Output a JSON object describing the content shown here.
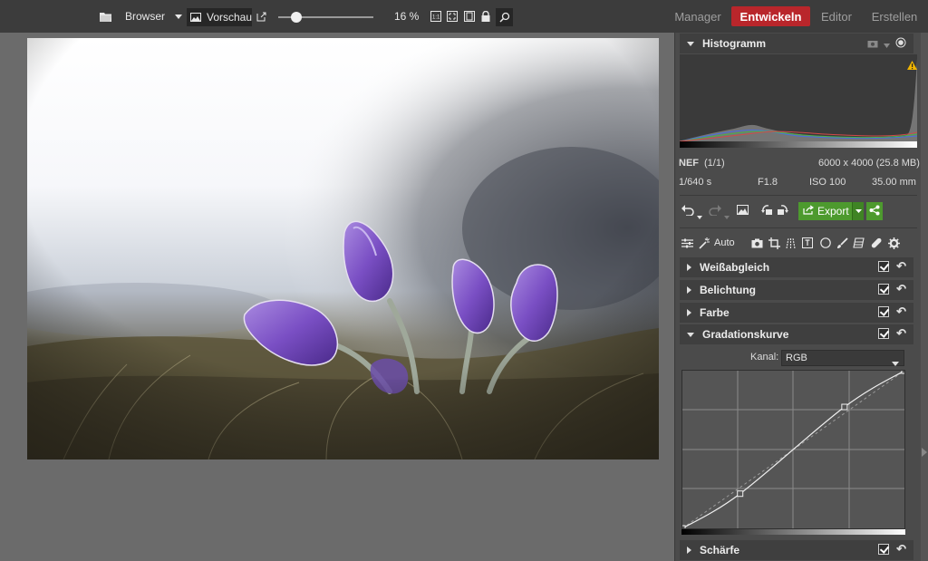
{
  "topbar": {
    "browser_label": "Browser",
    "preview_label": "Vorschau",
    "zoom_value": "16 %",
    "zoom_fraction": 0.16,
    "tabs": [
      {
        "label": "Manager",
        "active": false
      },
      {
        "label": "Entwickeln",
        "active": true
      },
      {
        "label": "Editor",
        "active": false
      },
      {
        "label": "Erstellen",
        "active": false
      }
    ]
  },
  "colors": {
    "accent_active_tab": "#b9262b",
    "export_green": "#4d9a2e",
    "panel_bg": "#4b4b4b",
    "topbar_bg": "#3c3c3c",
    "canvas_bg": "#6b6b6b"
  },
  "histogram": {
    "title": "Histogramm",
    "warning_icon": "warning-icon"
  },
  "file_info": {
    "format": "NEF",
    "counter": "(1/1)",
    "dimensions": "6000 x 4000 (25.8 MB)",
    "shutter": "1/640 s",
    "aperture": "F1.8",
    "iso": "ISO 100",
    "focal_length": "35.00 mm"
  },
  "toolbar": {
    "export_label": "Export",
    "auto_label": "Auto"
  },
  "sections": [
    {
      "label": "Weißabgleich",
      "expanded": false,
      "checked": true
    },
    {
      "label": "Belichtung",
      "expanded": false,
      "checked": true
    },
    {
      "label": "Farbe",
      "expanded": false,
      "checked": true
    },
    {
      "label": "Gradationskurve",
      "expanded": true,
      "checked": true
    },
    {
      "label": "Schärfe",
      "expanded": false,
      "checked": true
    }
  ],
  "curve": {
    "channel_label": "Kanal:",
    "channel_value": "RGB",
    "control_points": [
      [
        0,
        0
      ],
      [
        0.26,
        0.22
      ],
      [
        0.73,
        0.77
      ],
      [
        1,
        1
      ]
    ]
  }
}
